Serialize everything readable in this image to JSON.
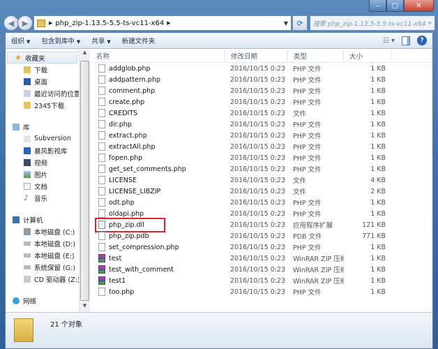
{
  "window": {
    "controls": [
      "minimize",
      "maximize",
      "close"
    ]
  },
  "address": {
    "path": "php_zip-1.13.5-5.5-ts-vc11-x64",
    "search_placeholder": "搜索 php_zip-1.13.5-5.5-ts-vc11-x64"
  },
  "toolbar": {
    "organize": "组织",
    "include_library": "包含到库中",
    "share": "共享",
    "new_folder": "新建文件夹"
  },
  "nav": {
    "favorites": {
      "label": "收藏夹",
      "items": [
        "下载",
        "桌面",
        "最近访问的位置",
        "2345下载"
      ]
    },
    "libraries": {
      "label": "库",
      "items": [
        "Subversion",
        "暴风影视库",
        "视频",
        "图片",
        "文档",
        "音乐"
      ]
    },
    "computer": {
      "label": "计算机",
      "items": [
        "本地磁盘 (C:)",
        "本地磁盘 (D:)",
        "本地磁盘 (E:)",
        "系统保留 (G:)",
        "CD 驱动器 (Z:)"
      ]
    },
    "network": {
      "label": "网络"
    }
  },
  "columns": {
    "name": "名称",
    "date": "修改日期",
    "type": "类型",
    "size": "大小"
  },
  "files": [
    {
      "name": "addglob.php",
      "date": "2016/10/15 0:23",
      "type": "PHP 文件",
      "size": "1 KB",
      "icon": "file"
    },
    {
      "name": "addpattern.php",
      "date": "2016/10/15 0:23",
      "type": "PHP 文件",
      "size": "1 KB",
      "icon": "file"
    },
    {
      "name": "comment.php",
      "date": "2016/10/15 0:23",
      "type": "PHP 文件",
      "size": "1 KB",
      "icon": "file"
    },
    {
      "name": "create.php",
      "date": "2016/10/15 0:23",
      "type": "PHP 文件",
      "size": "1 KB",
      "icon": "file"
    },
    {
      "name": "CREDITS",
      "date": "2016/10/15 0:23",
      "type": "文件",
      "size": "1 KB",
      "icon": "file"
    },
    {
      "name": "dir.php",
      "date": "2016/10/15 0:23",
      "type": "PHP 文件",
      "size": "1 KB",
      "icon": "file"
    },
    {
      "name": "extract.php",
      "date": "2016/10/15 0:23",
      "type": "PHP 文件",
      "size": "1 KB",
      "icon": "file"
    },
    {
      "name": "extractAll.php",
      "date": "2016/10/15 0:23",
      "type": "PHP 文件",
      "size": "1 KB",
      "icon": "file"
    },
    {
      "name": "fopen.php",
      "date": "2016/10/15 0:23",
      "type": "PHP 文件",
      "size": "1 KB",
      "icon": "file"
    },
    {
      "name": "get_set_comments.php",
      "date": "2016/10/15 0:23",
      "type": "PHP 文件",
      "size": "1 KB",
      "icon": "file"
    },
    {
      "name": "LICENSE",
      "date": "2016/10/15 0:23",
      "type": "文件",
      "size": "4 KB",
      "icon": "file"
    },
    {
      "name": "LICENSE_LIBZIP",
      "date": "2016/10/15 0:23",
      "type": "文件",
      "size": "2 KB",
      "icon": "file"
    },
    {
      "name": "odt.php",
      "date": "2016/10/15 0:23",
      "type": "PHP 文件",
      "size": "1 KB",
      "icon": "file"
    },
    {
      "name": "oldapi.php",
      "date": "2016/10/15 0:23",
      "type": "PHP 文件",
      "size": "1 KB",
      "icon": "file"
    },
    {
      "name": "php_zip.dll",
      "date": "2016/10/15 0:23",
      "type": "应用程序扩展",
      "size": "121 KB",
      "icon": "dll",
      "highlight": true
    },
    {
      "name": "php_zip.pdb",
      "date": "2016/10/15 0:23",
      "type": "PDB 文件",
      "size": "771 KB",
      "icon": "file"
    },
    {
      "name": "set_compression.php",
      "date": "2016/10/15 0:23",
      "type": "PHP 文件",
      "size": "1 KB",
      "icon": "file"
    },
    {
      "name": "test",
      "date": "2016/10/15 0:23",
      "type": "WinRAR ZIP 压缩...",
      "size": "1 KB",
      "icon": "rar"
    },
    {
      "name": "test_with_comment",
      "date": "2016/10/15 0:23",
      "type": "WinRAR ZIP 压缩...",
      "size": "1 KB",
      "icon": "rar"
    },
    {
      "name": "test1",
      "date": "2016/10/15 0:23",
      "type": "WinRAR ZIP 压缩...",
      "size": "1 KB",
      "icon": "rar"
    },
    {
      "name": "too.php",
      "date": "2016/10/15 0:23",
      "type": "PHP 文件",
      "size": "1 KB",
      "icon": "file"
    }
  ],
  "status": {
    "count": "21 个对象"
  },
  "colors": {
    "highlight_box": "#e0242a",
    "title_bar": "#3f73ad"
  }
}
